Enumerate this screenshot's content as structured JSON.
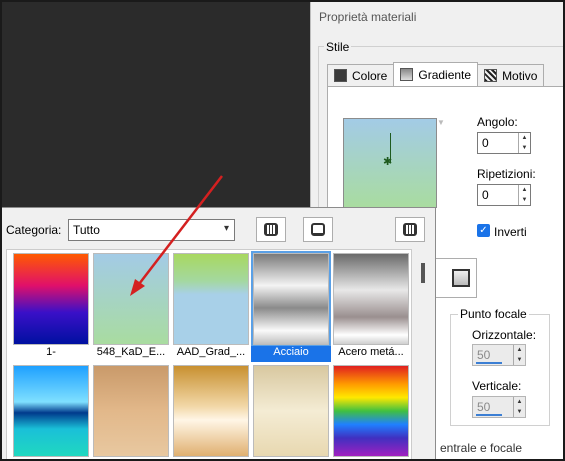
{
  "dialog": {
    "title": "Proprietà materiali",
    "group_label": "Stile",
    "tabs": [
      {
        "label": "Colore",
        "icon": "colore-icon",
        "active": false
      },
      {
        "label": "Gradiente",
        "icon": "gradiente-icon",
        "active": true
      },
      {
        "label": "Motivo",
        "icon": "motivo-icon",
        "active": false
      }
    ],
    "angolo": {
      "label": "Angolo:",
      "value": "0"
    },
    "ripetizioni": {
      "label": "Ripetizioni:",
      "value": "0"
    },
    "inverti": {
      "label": "Inverti",
      "checked": true
    },
    "punto_focale": {
      "label": "Punto focale",
      "orizzontale": {
        "label": "Orizzontale:",
        "value": "50"
      },
      "verticale": {
        "label": "Verticale:",
        "value": "50"
      }
    },
    "bottom_partial": "entrale e focale"
  },
  "picker": {
    "category_label": "Categoria:",
    "category_value": "Tutto",
    "gradients_row1": [
      {
        "name": "1-",
        "selected": false
      },
      {
        "name": "548_KaD_E...",
        "selected": false
      },
      {
        "name": "AAD_Grad_...",
        "selected": false
      },
      {
        "name": "Acciaio",
        "selected": true
      },
      {
        "name": "Acero metá...",
        "selected": false
      }
    ],
    "gradients_row2": [
      {
        "name": "",
        "selected": false
      },
      {
        "name": "",
        "selected": false
      },
      {
        "name": "",
        "selected": false
      },
      {
        "name": "",
        "selected": false
      },
      {
        "name": "",
        "selected": false
      }
    ]
  },
  "colors": {
    "accent": "#1a73e8",
    "annotation_arrow": "#d42020",
    "desktop": "#2b2b2b"
  }
}
